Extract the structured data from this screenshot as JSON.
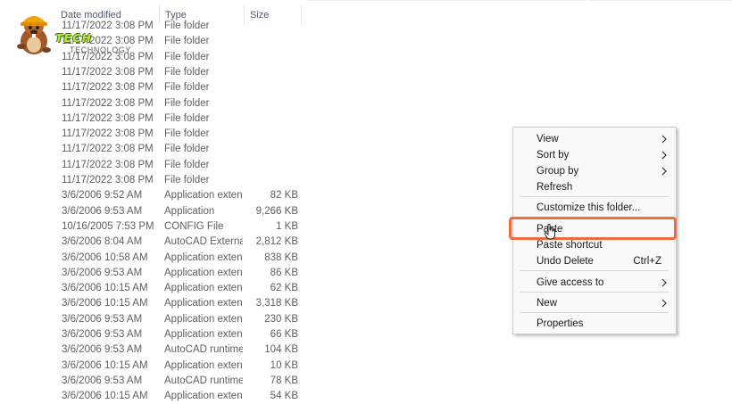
{
  "columns": {
    "date": "Date modified",
    "type": "Type",
    "size": "Size"
  },
  "logo": {
    "line1": "TECH",
    "line2": "TECHNOLOGY"
  },
  "rows": [
    {
      "date": "11/17/2022 3:08 PM",
      "type": "File folder",
      "size": ""
    },
    {
      "date": "11/17/2022 3:08 PM",
      "type": "File folder",
      "size": ""
    },
    {
      "date": "11/17/2022 3:08 PM",
      "type": "File folder",
      "size": ""
    },
    {
      "date": "11/17/2022 3:08 PM",
      "type": "File folder",
      "size": ""
    },
    {
      "date": "11/17/2022 3:08 PM",
      "type": "File folder",
      "size": ""
    },
    {
      "date": "11/17/2022 3:08 PM",
      "type": "File folder",
      "size": ""
    },
    {
      "date": "11/17/2022 3:08 PM",
      "type": "File folder",
      "size": ""
    },
    {
      "date": "11/17/2022 3:08 PM",
      "type": "File folder",
      "size": ""
    },
    {
      "date": "11/17/2022 3:08 PM",
      "type": "File folder",
      "size": ""
    },
    {
      "date": "11/17/2022 3:08 PM",
      "type": "File folder",
      "size": ""
    },
    {
      "date": "11/17/2022 3:08 PM",
      "type": "File folder",
      "size": ""
    },
    {
      "date": "3/6/2006 9:52 AM",
      "type": "Application extens...",
      "size": "82 KB"
    },
    {
      "date": "3/6/2006 9:53 AM",
      "type": "Application",
      "size": "9,266 KB"
    },
    {
      "date": "10/16/2005 7:53 PM",
      "type": "CONFIG File",
      "size": "1 KB"
    },
    {
      "date": "3/6/2006 8:04 AM",
      "type": "AutoCAD External ...",
      "size": "2,812 KB"
    },
    {
      "date": "3/6/2006 10:58 AM",
      "type": "Application extens...",
      "size": "838 KB"
    },
    {
      "date": "3/6/2006 9:53 AM",
      "type": "Application extens...",
      "size": "86 KB"
    },
    {
      "date": "3/6/2006 10:15 AM",
      "type": "Application extens...",
      "size": "62 KB"
    },
    {
      "date": "3/6/2006 10:15 AM",
      "type": "Application extens...",
      "size": "3,318 KB"
    },
    {
      "date": "3/6/2006 9:53 AM",
      "type": "Application extens...",
      "size": "230 KB"
    },
    {
      "date": "3/6/2006 9:53 AM",
      "type": "Application extens...",
      "size": "66 KB"
    },
    {
      "date": "3/6/2006 9:53 AM",
      "type": "AutoCAD runtime ...",
      "size": "104 KB"
    },
    {
      "date": "3/6/2006 10:15 AM",
      "type": "Application extens...",
      "size": "10 KB"
    },
    {
      "date": "3/6/2006 9:53 AM",
      "type": "AutoCAD runtime ...",
      "size": "78 KB"
    },
    {
      "date": "3/6/2006 10:15 AM",
      "type": "Application extens...",
      "size": "54 KB"
    }
  ],
  "menu": {
    "view": "View",
    "sort_by": "Sort by",
    "group_by": "Group by",
    "refresh": "Refresh",
    "customize": "Customize this folder...",
    "paste": "Paste",
    "paste_shortcut": "Paste shortcut",
    "undo_delete": "Undo Delete",
    "undo_delete_shortcut": "Ctrl+Z",
    "give_access": "Give access to",
    "new": "New",
    "properties": "Properties"
  },
  "colors": {
    "highlight": "#f06a3e",
    "menu_bg": "#f9f9f9"
  }
}
